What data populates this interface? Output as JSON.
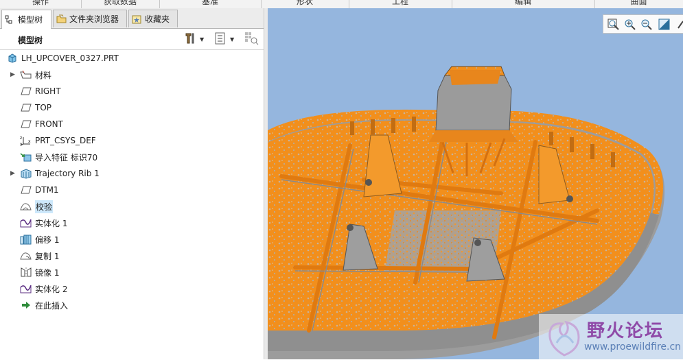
{
  "ribbon": {
    "groups": [
      "操作",
      "获取数据",
      "基准",
      "形状",
      "工程",
      "编辑",
      "曲面"
    ]
  },
  "tabs": [
    {
      "label": "模型树",
      "icon": "model-tree-icon",
      "active": true
    },
    {
      "label": "文件夹浏览器",
      "icon": "folder-browser-icon",
      "active": false
    },
    {
      "label": "收藏夹",
      "icon": "favorites-icon",
      "active": false
    }
  ],
  "tree_header": {
    "title": "模型树",
    "tools": [
      "settings-tools-icon",
      "show-list-icon",
      "filter-icon"
    ]
  },
  "tree": {
    "root": {
      "label": "LH_UPCOVER_0327.PRT",
      "icon": "part-icon"
    },
    "items": [
      {
        "label": "材料",
        "icon": "material-icon",
        "expandable": true
      },
      {
        "label": "RIGHT",
        "icon": "datum-plane-icon",
        "expandable": false
      },
      {
        "label": "TOP",
        "icon": "datum-plane-icon",
        "expandable": false
      },
      {
        "label": "FRONT",
        "icon": "datum-plane-icon",
        "expandable": false
      },
      {
        "label": "PRT_CSYS_DEF",
        "icon": "csys-icon",
        "expandable": false
      },
      {
        "label": "导入特征 标识70",
        "icon": "import-feature-icon",
        "expandable": false
      },
      {
        "label": "Trajectory Rib 1",
        "icon": "trajectory-rib-icon",
        "expandable": true
      },
      {
        "label": "DTM1",
        "icon": "datum-plane-icon",
        "expandable": false
      },
      {
        "label": "校验",
        "icon": "quilt-icon",
        "expandable": false,
        "selected": true
      },
      {
        "label": "实体化 1",
        "icon": "solidify-icon",
        "expandable": false
      },
      {
        "label": "偏移 1",
        "icon": "offset-icon",
        "expandable": false
      },
      {
        "label": "复制 1",
        "icon": "copy-icon",
        "expandable": false
      },
      {
        "label": "镜像 1",
        "icon": "mirror-icon",
        "expandable": false
      },
      {
        "label": "实体化 2",
        "icon": "solidify-icon",
        "expandable": false
      },
      {
        "label": "在此插入",
        "icon": "insert-here-icon",
        "expandable": false
      }
    ]
  },
  "viewport": {
    "toolbar": [
      "zoom-fit-icon",
      "zoom-in-icon",
      "zoom-out-icon",
      "shading-icon",
      "more-icon"
    ],
    "colors": {
      "background": "#95b6de",
      "surface": "#f28f1c",
      "gray": "#a2a2a2"
    }
  },
  "watermark": {
    "title": "野火论坛",
    "url": "www.proewildfire.cn"
  }
}
